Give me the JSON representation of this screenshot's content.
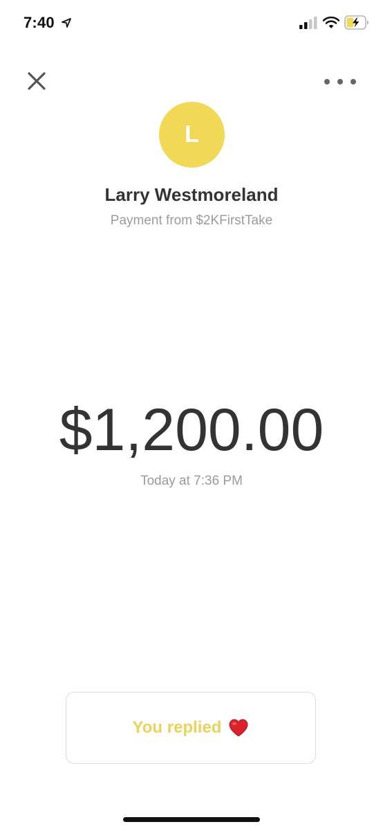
{
  "status_bar": {
    "time": "7:40",
    "icons": [
      "location-arrow-icon",
      "cellular-signal-icon",
      "wifi-icon",
      "battery-charging-icon"
    ]
  },
  "header": {
    "close_icon": "close-icon",
    "more_icon": "more-horizontal-icon"
  },
  "sender": {
    "avatar_initial": "L",
    "avatar_color": "#f2d857",
    "name": "Larry Westmoreland",
    "subtitle": "Payment from $2KFirstTake"
  },
  "payment": {
    "amount": "$1,200.00",
    "timestamp": "Today at 7:36 PM"
  },
  "reply": {
    "label": "You replied",
    "emoji_icon": "red-heart-icon",
    "label_color": "#ecd25a"
  }
}
